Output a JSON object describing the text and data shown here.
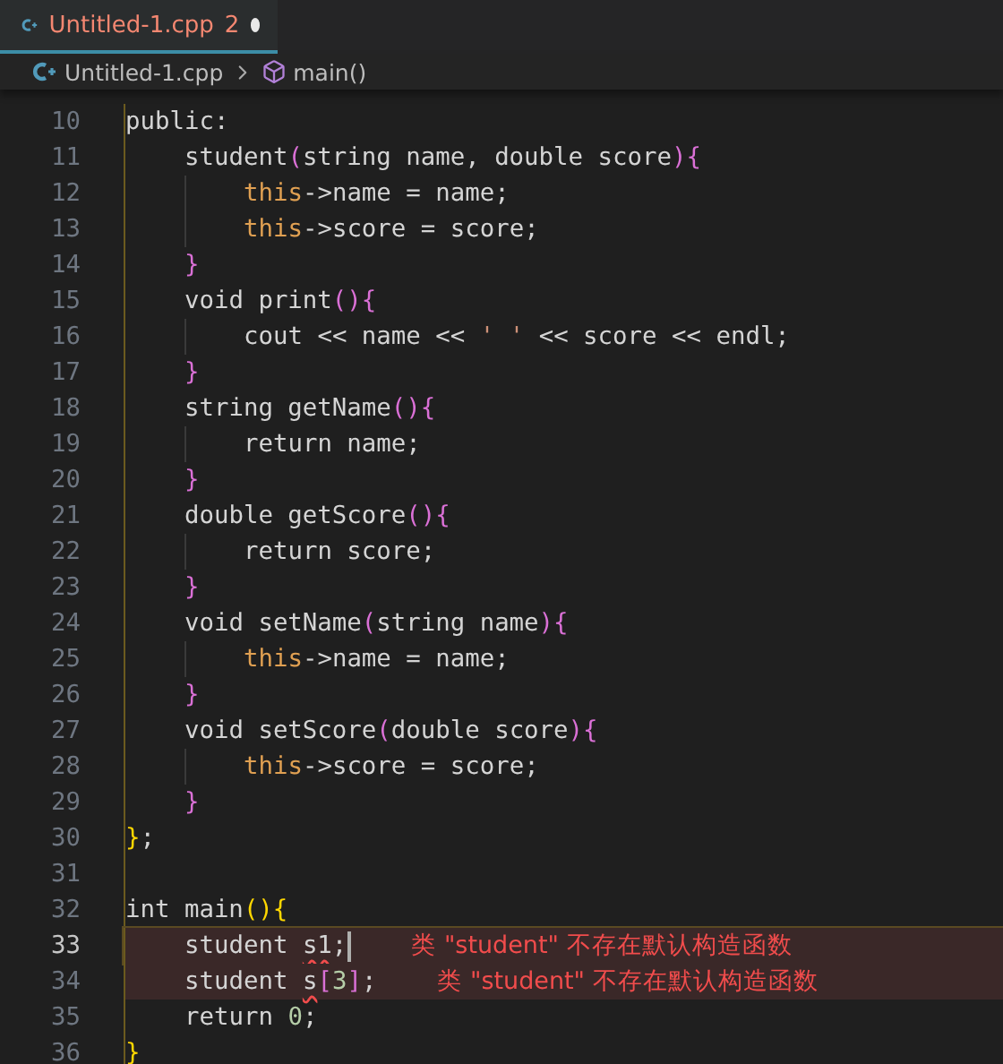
{
  "tab": {
    "label": "Untitled-1.cpp",
    "problems": "2",
    "modified": true,
    "selected": true
  },
  "breadcrumbs": [
    {
      "kind": "file",
      "label": "Untitled-1.cpp"
    },
    {
      "kind": "function",
      "label": "main()"
    }
  ],
  "lines": [
    {
      "number": "10",
      "current": false,
      "tokens": [
        {
          "kind": "plain",
          "text": "public:"
        }
      ],
      "children": [
        {
          "number": "11",
          "current": false,
          "tokens": [
            {
              "kind": "plain",
              "text": "student"
            },
            {
              "kind": "b2",
              "text": "("
            },
            {
              "kind": "plain",
              "text": "string name, double score"
            },
            {
              "kind": "b2",
              "text": ")"
            },
            {
              "kind": "b2",
              "text": "{"
            }
          ],
          "children": [
            {
              "number": "12",
              "current": false,
              "tokens": [
                {
                  "kind": "this",
                  "text": "this"
                },
                {
                  "kind": "plain",
                  "text": "->name = name;"
                }
              ]
            },
            {
              "number": "13",
              "current": false,
              "tokens": [
                {
                  "kind": "this",
                  "text": "this"
                },
                {
                  "kind": "plain",
                  "text": "->score = score;"
                }
              ]
            }
          ]
        },
        {
          "number": "14",
          "current": false,
          "tokens": [
            {
              "kind": "b2",
              "text": "}"
            }
          ]
        },
        {
          "number": "15",
          "current": false,
          "tokens": [
            {
              "kind": "plain",
              "text": "void print"
            },
            {
              "kind": "b2",
              "text": "()"
            },
            {
              "kind": "b2",
              "text": "{"
            }
          ],
          "children": [
            {
              "number": "16",
              "current": false,
              "tokens": [
                {
                  "kind": "plain",
                  "text": "cout << name << "
                },
                {
                  "kind": "str",
                  "text": "' '"
                },
                {
                  "kind": "plain",
                  "text": " << score << endl;"
                }
              ]
            }
          ]
        },
        {
          "number": "17",
          "current": false,
          "tokens": [
            {
              "kind": "b2",
              "text": "}"
            }
          ]
        },
        {
          "number": "18",
          "current": false,
          "tokens": [
            {
              "kind": "plain",
              "text": "string getName"
            },
            {
              "kind": "b2",
              "text": "()"
            },
            {
              "kind": "b2",
              "text": "{"
            }
          ],
          "children": [
            {
              "number": "19",
              "current": false,
              "tokens": [
                {
                  "kind": "plain",
                  "text": "return name;"
                }
              ]
            }
          ]
        },
        {
          "number": "20",
          "current": false,
          "tokens": [
            {
              "kind": "b2",
              "text": "}"
            }
          ]
        },
        {
          "number": "21",
          "current": false,
          "tokens": [
            {
              "kind": "plain",
              "text": "double getScore"
            },
            {
              "kind": "b2",
              "text": "()"
            },
            {
              "kind": "b2",
              "text": "{"
            }
          ],
          "children": [
            {
              "number": "22",
              "current": false,
              "tokens": [
                {
                  "kind": "plain",
                  "text": "return score;"
                }
              ]
            }
          ]
        },
        {
          "number": "23",
          "current": false,
          "tokens": [
            {
              "kind": "b2",
              "text": "}"
            }
          ]
        },
        {
          "number": "24",
          "current": false,
          "tokens": [
            {
              "kind": "plain",
              "text": "void setName"
            },
            {
              "kind": "b2",
              "text": "("
            },
            {
              "kind": "plain",
              "text": "string name"
            },
            {
              "kind": "b2",
              "text": ")"
            },
            {
              "kind": "b2",
              "text": "{"
            }
          ],
          "children": [
            {
              "number": "25",
              "current": false,
              "tokens": [
                {
                  "kind": "this",
                  "text": "this"
                },
                {
                  "kind": "plain",
                  "text": "->name = name;"
                }
              ]
            }
          ]
        },
        {
          "number": "26",
          "current": false,
          "tokens": [
            {
              "kind": "b2",
              "text": "}"
            }
          ]
        },
        {
          "number": "27",
          "current": false,
          "tokens": [
            {
              "kind": "plain",
              "text": "void setScore"
            },
            {
              "kind": "b2",
              "text": "("
            },
            {
              "kind": "plain",
              "text": "double score"
            },
            {
              "kind": "b2",
              "text": ")"
            },
            {
              "kind": "b2",
              "text": "{"
            }
          ],
          "children": [
            {
              "number": "28",
              "current": false,
              "tokens": [
                {
                  "kind": "this",
                  "text": "this"
                },
                {
                  "kind": "plain",
                  "text": "->score = score;"
                }
              ]
            }
          ]
        },
        {
          "number": "29",
          "current": false,
          "tokens": [
            {
              "kind": "b2",
              "text": "}"
            }
          ]
        }
      ]
    },
    {
      "number": "30",
      "current": false,
      "tokens": [
        {
          "kind": "b1",
          "text": "}"
        },
        {
          "kind": "plain",
          "text": ";"
        }
      ]
    },
    {
      "number": "31",
      "current": false
    },
    {
      "number": "32",
      "current": false,
      "tokens": [
        {
          "kind": "plain",
          "text": "int main"
        },
        {
          "kind": "b1",
          "text": "()"
        },
        {
          "kind": "b1",
          "text": "{"
        }
      ],
      "children": [
        {
          "number": "33",
          "current": true,
          "error": "类 \"student\" 不存在默认构造函数",
          "tokens": [
            {
              "kind": "plain",
              "text": "student "
            },
            {
              "kind": "squiggle",
              "text": "s1"
            },
            {
              "kind": "plain",
              "text": ";"
            }
          ]
        },
        {
          "number": "34",
          "current": false,
          "error": "类 \"student\" 不存在默认构造函数",
          "tokens": [
            {
              "kind": "plain",
              "text": "student "
            },
            {
              "kind": "squiggle",
              "text": "s"
            },
            {
              "kind": "b2",
              "text": "["
            },
            {
              "kind": "num",
              "text": "3"
            },
            {
              "kind": "b2",
              "text": "]"
            },
            {
              "kind": "plain",
              "text": ";"
            }
          ]
        },
        {
          "number": "35",
          "current": false,
          "tokens": [
            {
              "kind": "plain",
              "text": "return "
            },
            {
              "kind": "num",
              "text": "0"
            },
            {
              "kind": "plain",
              "text": ";"
            }
          ]
        }
      ]
    },
    {
      "number": "36",
      "current": false,
      "tokens": [
        {
          "kind": "b1",
          "text": "}"
        }
      ]
    }
  ]
}
